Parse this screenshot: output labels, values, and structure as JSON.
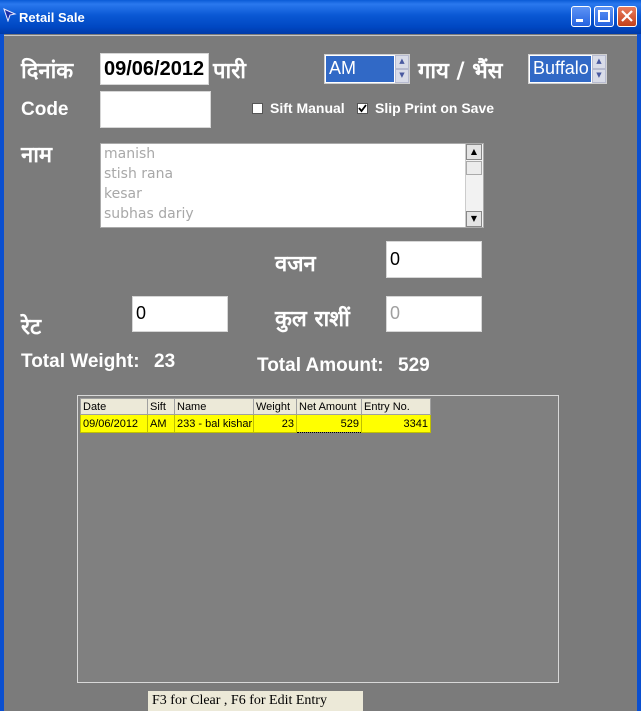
{
  "window": {
    "title": "Retail Sale"
  },
  "form": {
    "date_label": "दिनांक",
    "date_value": "09/06/2012",
    "pari_label": "पारी",
    "shift_value": "AM",
    "animal_label": "गाय / भैंस",
    "animal_value": "Buffalo",
    "code_label": "Code",
    "code_value": "",
    "sift_manual_label": "Sift Manual",
    "sift_manual_checked": false,
    "slip_print_label": "Slip Print on Save",
    "slip_print_checked": true,
    "name_label": "नाम",
    "names": [
      "manish",
      "stish rana",
      "kesar",
      "subhas dariy"
    ],
    "weight_label": "वजन",
    "weight_value": "0",
    "rate_label": "रेट",
    "rate_value": "0",
    "total_amount_label": "कुल राशीं",
    "total_amount_value": "0"
  },
  "totals": {
    "weight_label": "Total Weight:",
    "weight_value": "23",
    "amount_label": "Total Amount:",
    "amount_value": "529"
  },
  "grid": {
    "columns": [
      "Date",
      "Sift",
      "Name",
      "Weight",
      "Net Amount",
      "Entry No."
    ],
    "rows": [
      {
        "date": "09/06/2012",
        "sift": "AM",
        "name": "233 - bal kishar",
        "weight": "23",
        "net_amount": "529",
        "entry_no": "3341"
      }
    ]
  },
  "footer": {
    "hint": "F3 for Clear , F6 for Edit Entry"
  },
  "icons": {
    "app": "cursor-arrow-icon",
    "minimize": "minimize-icon",
    "maximize": "maximize-icon",
    "close": "close-icon",
    "check": "check-icon"
  },
  "colors": {
    "titlebar": "#0a58d4",
    "background": "#7b7b7b",
    "grid_row": "#ffff00",
    "spin_selected": "#3169c6"
  }
}
